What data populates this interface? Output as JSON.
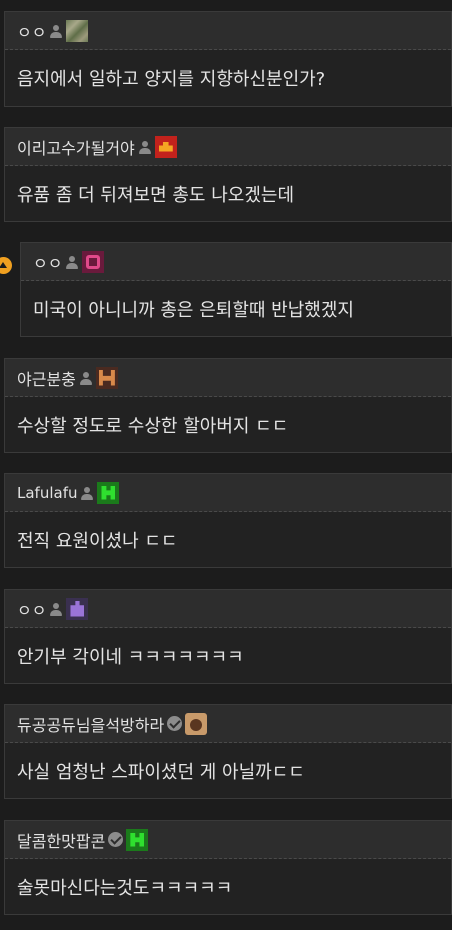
{
  "comments": [
    {
      "nickname": "ㅇㅇ",
      "avatar": "camouflage-pixel-avatar",
      "text": "음지에서 일하고 양지를 지향하신분인가?"
    },
    {
      "nickname": "이리고수가될거야",
      "avatar": "red-tank-pixel-avatar",
      "text": "유품 좀 더 뒤져보면 총도 나오겠는데"
    },
    {
      "nickname": "ㅇㅇ",
      "avatar": "pink-invader-pixel-avatar",
      "text": "미국이 아니니까 총은 은퇴할때 반납했겠지",
      "is_reply": true
    },
    {
      "nickname": "야근분충",
      "avatar": "brown-invader-pixel-avatar",
      "text": "수상할 정도로 수상한 할아버지 ㄷㄷ"
    },
    {
      "nickname": "Lafulafu",
      "avatar": "green-creeper-pixel-avatar",
      "text": "전직 요원이셨나 ㄷㄷ"
    },
    {
      "nickname": "ㅇㅇ",
      "avatar": "purple-ship-pixel-avatar",
      "text": "안기부 각이네 ㅋㅋㅋㅋㅋㅋㅋ"
    },
    {
      "nickname": "듀공공듀님을석방하라",
      "avatar": "bear-photo-avatar",
      "verified": true,
      "text": "사실 엄청난 스파이셨던 게 아닐까ㄷㄷ"
    },
    {
      "nickname": "달콤한맛팝콘",
      "avatar": "green-creeper-pixel-avatar",
      "verified": true,
      "text": "술못마신다는것도ㅋㅋㅋㅋㅋ"
    }
  ]
}
